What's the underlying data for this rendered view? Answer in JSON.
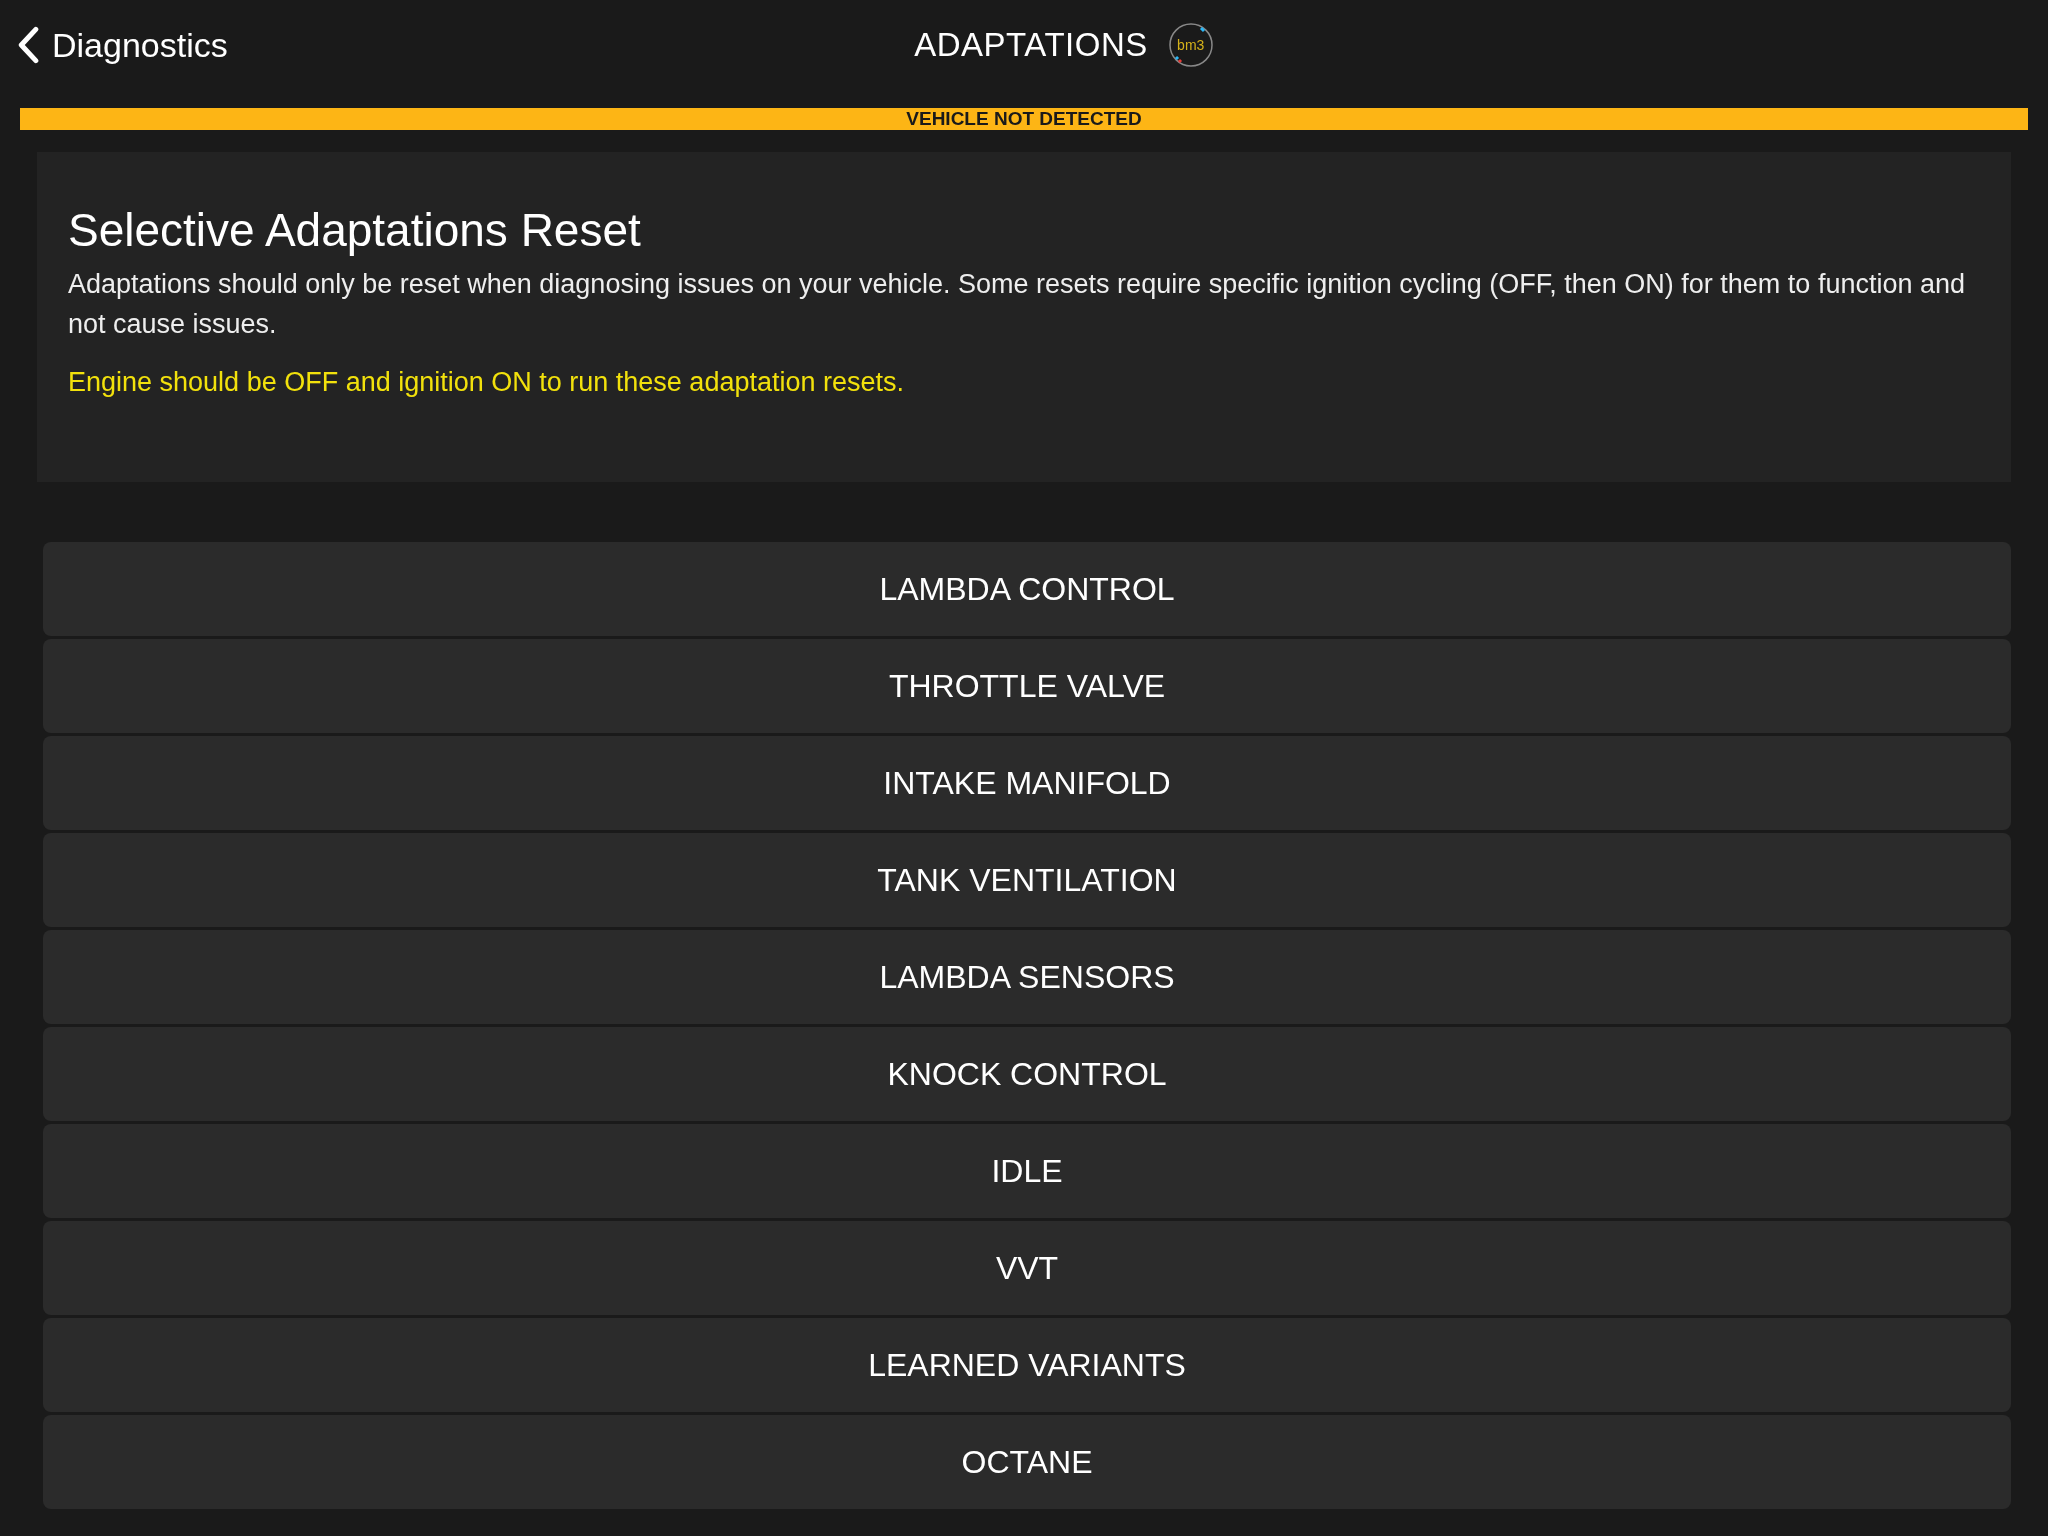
{
  "nav": {
    "back_label": "Diagnostics",
    "title": "ADAPTATIONS",
    "logo_text": "bm3"
  },
  "status_banner": "VEHICLE NOT DETECTED",
  "info": {
    "heading": "Selective Adaptations Reset",
    "description": "Adaptations should only be reset when diagnosing issues on your vehicle. Some resets require specific ignition cycling (OFF, then ON) for them to function and not cause issues.",
    "warning": "Engine should be OFF and ignition ON to run these adaptation resets."
  },
  "reset_buttons": [
    "LAMBDA CONTROL",
    "THROTTLE VALVE",
    "INTAKE MANIFOLD",
    "TANK VENTILATION",
    "LAMBDA SENSORS",
    "KNOCK CONTROL",
    "IDLE",
    "VVT",
    "LEARNED VARIANTS",
    "OCTANE"
  ]
}
